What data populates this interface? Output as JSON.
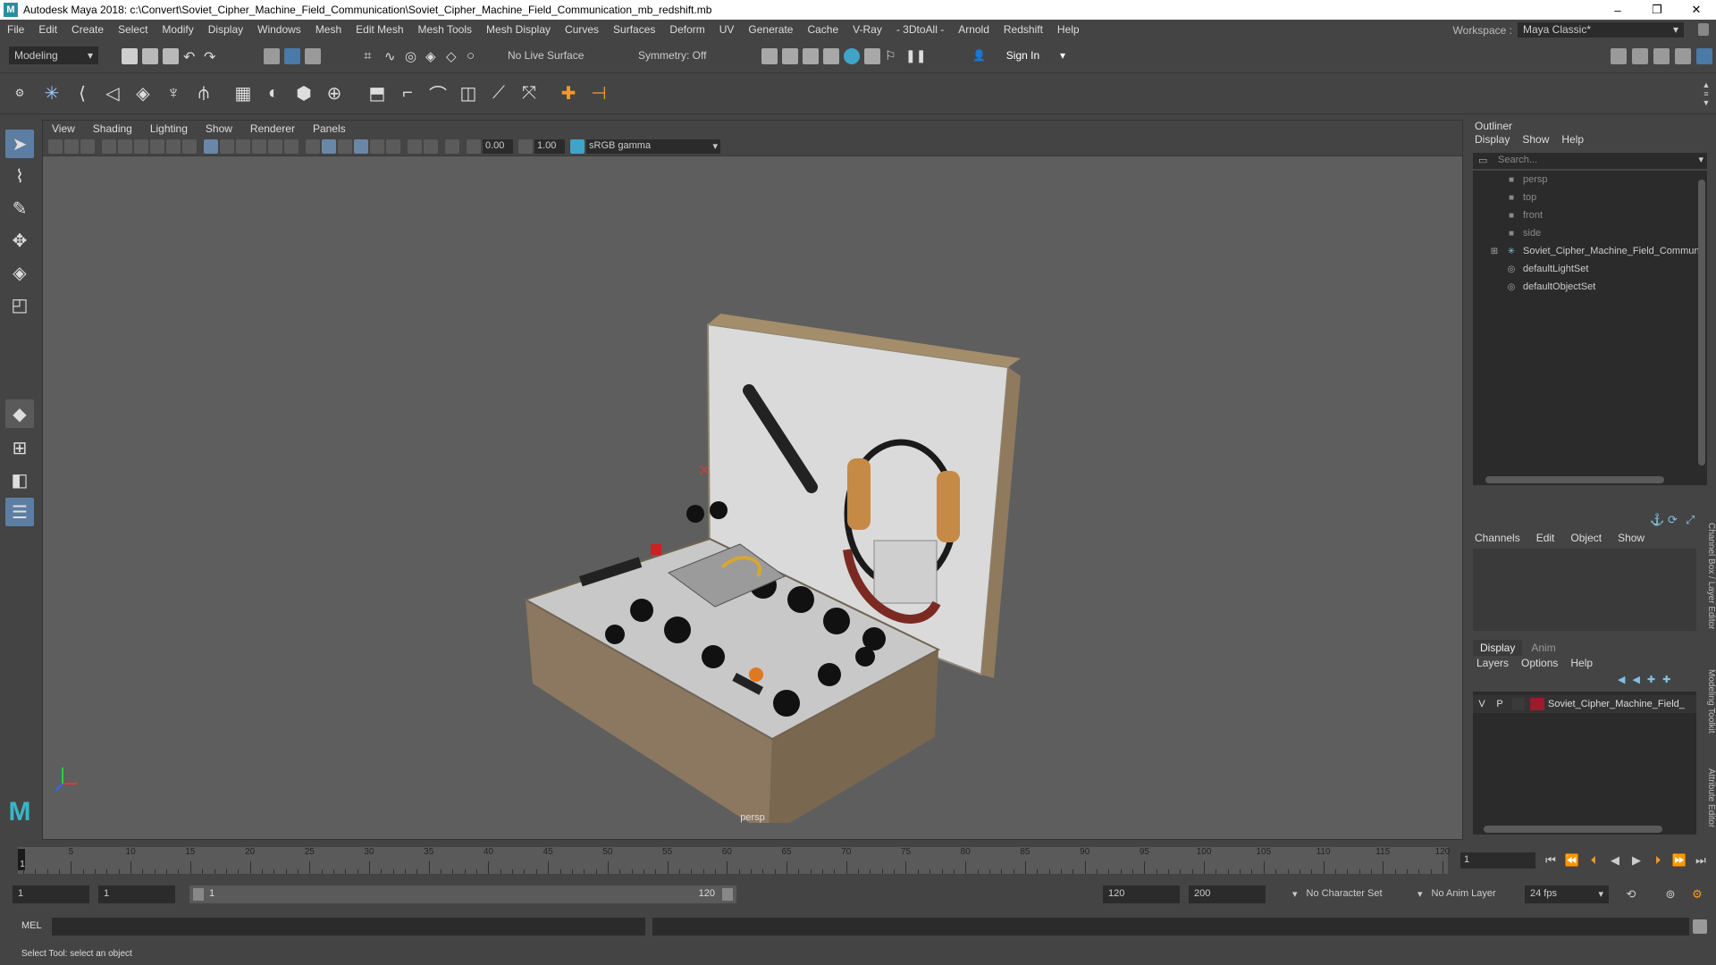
{
  "titlebar": {
    "title": "Autodesk Maya 2018: c:\\Convert\\Soviet_Cipher_Machine_Field_Communication\\Soviet_Cipher_Machine_Field_Communication_mb_redshift.mb",
    "minimize": "–",
    "maximize": "❐",
    "close": "✕"
  },
  "menubar": {
    "items": [
      "File",
      "Edit",
      "Create",
      "Select",
      "Modify",
      "Display",
      "Windows",
      "Mesh",
      "Edit Mesh",
      "Mesh Tools",
      "Mesh Display",
      "Curves",
      "Surfaces",
      "Deform",
      "UV",
      "Generate",
      "Cache",
      "V-Ray",
      "- 3DtoAll -",
      "Arnold",
      "Redshift",
      "Help"
    ],
    "workspace_label": "Workspace :",
    "workspace_value": "Maya Classic*"
  },
  "statusline": {
    "mode": "Modeling",
    "live_surface": "No Live Surface",
    "symmetry": "Symmetry: Off",
    "sign_in": "Sign In"
  },
  "viewport": {
    "menu": [
      "View",
      "Shading",
      "Lighting",
      "Show",
      "Renderer",
      "Panels"
    ],
    "exposure": "0.00",
    "gamma": "1.00",
    "color_space": "sRGB gamma",
    "camera": "persp"
  },
  "outliner": {
    "title": "Outliner",
    "menu": [
      "Display",
      "Show",
      "Help"
    ],
    "search_placeholder": "Search...",
    "items": [
      {
        "label": "persp",
        "icon": "camera-icon",
        "dim": true
      },
      {
        "label": "top",
        "icon": "camera-icon",
        "dim": true
      },
      {
        "label": "front",
        "icon": "camera-icon",
        "dim": true
      },
      {
        "label": "side",
        "icon": "camera-icon",
        "dim": true
      },
      {
        "label": "Soviet_Cipher_Machine_Field_Communi",
        "icon": "group-icon",
        "dim": false
      },
      {
        "label": "defaultLightSet",
        "icon": "set-icon",
        "dim": false
      },
      {
        "label": "defaultObjectSet",
        "icon": "set-icon",
        "dim": false
      }
    ]
  },
  "channelbox": {
    "menu": [
      "Channels",
      "Edit",
      "Object",
      "Show"
    ],
    "tabs": [
      "Display",
      "Anim"
    ],
    "layer_menu": [
      "Layers",
      "Options",
      "Help"
    ],
    "layer": {
      "v": "V",
      "p": "P",
      "name": "Soviet_Cipher_Machine_Field_",
      "color": "#a0182c"
    },
    "side_tabs": [
      "Channel Box / Layer Editor",
      "Modeling Toolkit",
      "Attribute Editor"
    ]
  },
  "timeline": {
    "ticks": [
      "5",
      "10",
      "15",
      "20",
      "25",
      "30",
      "35",
      "40",
      "45",
      "50",
      "55",
      "60",
      "65",
      "70",
      "75",
      "80",
      "85",
      "90",
      "95",
      "100",
      "105",
      "110",
      "115",
      "120"
    ],
    "start_label": "1",
    "current_frame": "1"
  },
  "range": {
    "start": "1",
    "playback_start": "1",
    "slider_start": "1",
    "slider_end": "120",
    "playback_end": "120",
    "end": "200",
    "character_set": "No Character Set",
    "anim_layer": "No Anim Layer",
    "fps": "24 fps"
  },
  "command": {
    "label": "MEL"
  },
  "helpline": {
    "text": "Select Tool: select an object"
  }
}
